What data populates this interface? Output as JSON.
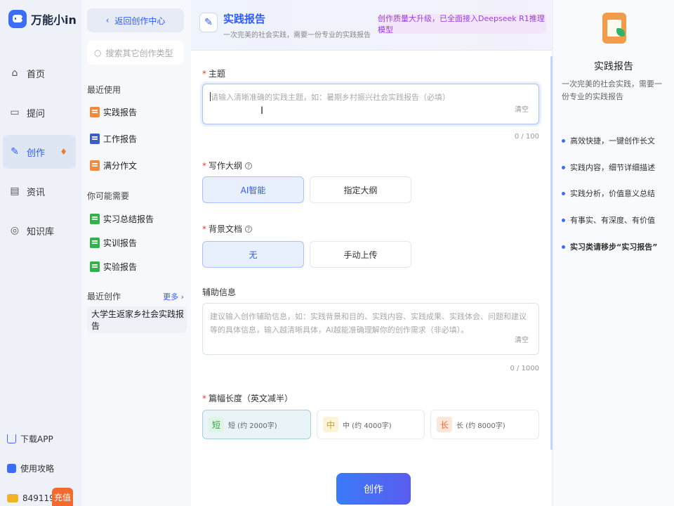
{
  "app": {
    "logo_text": "万能小in"
  },
  "nav": {
    "items": [
      {
        "label": "首页",
        "icon": "home-icon"
      },
      {
        "label": "提问",
        "icon": "chat-icon"
      },
      {
        "label": "创作",
        "icon": "pen-icon",
        "active": true
      },
      {
        "label": "资讯",
        "icon": "news-icon"
      },
      {
        "label": "知识库",
        "icon": "knowledge-icon"
      }
    ],
    "download_app": "下载APP",
    "guide": "使用攻略",
    "points": "8491190",
    "recharge": "充值"
  },
  "sub": {
    "back_label": "返回创作中心",
    "search_placeholder": "搜索其它创作类型",
    "recent_used_title": "最近使用",
    "recent_used": [
      "实践报告",
      "工作报告",
      "满分作文"
    ],
    "maybe_need_title": "你可能需要",
    "maybe_need": [
      "实习总结报告",
      "实训报告",
      "实验报告"
    ],
    "recent_created_title": "最近创作",
    "more_label": "更多 ›",
    "recent_created": [
      "大学生返家乡社会实践报告"
    ]
  },
  "main": {
    "title": "实践报告",
    "desc": "一次完美的社会实践，需要一份专业的实践报告",
    "promo": "创作质量大升级，已全面接入Deepseek R1推理模型",
    "topic": {
      "label": "主题",
      "placeholder": "请输入清晰准确的实践主题，如：暑期乡村振兴社会实践报告（必填）",
      "clear": "清空",
      "counter": "0 / 100"
    },
    "outline": {
      "label": "写作大纲",
      "options": [
        "AI智能",
        "指定大纲"
      ],
      "selected": "AI智能"
    },
    "background": {
      "label": "背景文档",
      "options": [
        "无",
        "手动上传"
      ],
      "selected": "无"
    },
    "aux": {
      "label": "辅助信息",
      "placeholder": "建议输入创作辅助信息，如：实践背景和目的、实践内容、实践成果、实践体会、问题和建议等的具体信息，输入越清晰具体，AI越能准确理解你的创作需求（非必填）。",
      "clear": "清空",
      "counter": "0 / 1000"
    },
    "length": {
      "label": "篇幅长度（英文减半）",
      "options": [
        {
          "badge": "短",
          "text": "短 (约 2000字)"
        },
        {
          "badge": "中",
          "text": "中 (约 4000字)"
        },
        {
          "badge": "长",
          "text": "长 (约 8000字)"
        }
      ],
      "selected": "短"
    },
    "create_label": "创作"
  },
  "right": {
    "title": "实践报告",
    "desc": "一次完美的社会实践，需要一份专业的实践报告",
    "points": [
      "高效快捷，一键创作长文",
      "实践内容，细节详细描述",
      "实践分析，价值意义总结",
      "有事实、有深度、有价值",
      "实习类请移步“实习报告”"
    ]
  },
  "colors": {
    "accent": "#2e5bff",
    "promo": "#9a3fe0",
    "recharge": "#f26a2e"
  }
}
